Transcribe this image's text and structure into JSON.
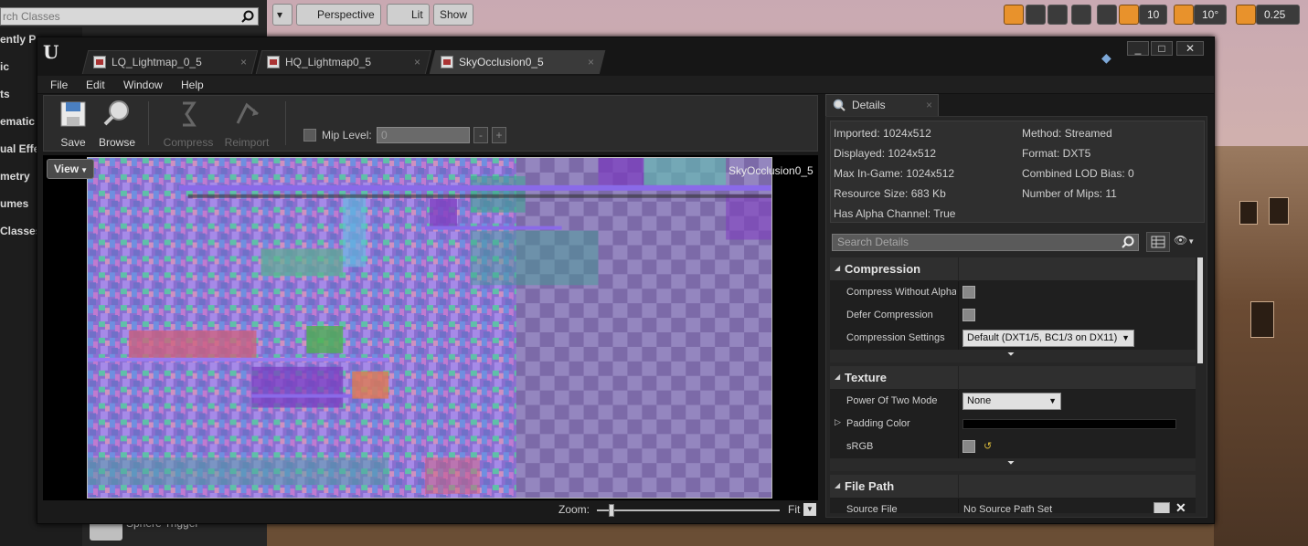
{
  "bg": {
    "search_placeholder": "rch Classes",
    "left_items": [
      "ently P",
      "ic",
      "ts",
      "ematic",
      "ual Effe",
      "metry",
      "umes",
      "Classes"
    ],
    "sphere_label": "Sphere Trigger",
    "vp_perspective": "Perspective",
    "vp_lit": "Lit",
    "vp_show": "Show",
    "vp_grid": "10",
    "vp_angle": "10°",
    "vp_scale": "0.25"
  },
  "window": {
    "tabs": [
      {
        "label": "LQ_Lightmap_0_5"
      },
      {
        "label": "HQ_Lightmap0_5"
      },
      {
        "label": "SkyOcclusion0_5"
      }
    ],
    "menu": [
      "File",
      "Edit",
      "Window",
      "Help"
    ],
    "toolbar": {
      "save": "Save",
      "browse": "Browse",
      "compress": "Compress",
      "reimport": "Reimport",
      "mip_label": "Mip Level:",
      "mip_value": "0",
      "minus": "-",
      "plus": "+"
    },
    "viewport": {
      "view_btn": "View",
      "texture_name": "SkyOcclusion0_5",
      "zoom_label": "Zoom:",
      "zoom_fraction": 0.08,
      "fit_label": "Fit"
    }
  },
  "details": {
    "tab_label": "Details",
    "info_left": [
      "Imported: 1024x512",
      "Displayed: 1024x512",
      "Max In-Game: 1024x512",
      "Resource Size: 683 Kb",
      "Has Alpha Channel: True"
    ],
    "info_right": [
      "Method: Streamed",
      "Format: DXT5",
      "Combined LOD Bias: 0",
      "Number of Mips: 11"
    ],
    "search_placeholder": "Search Details",
    "compression": {
      "title": "Compression",
      "compress_without_alpha": "Compress Without Alpha",
      "defer_compression": "Defer Compression",
      "compression_settings": "Compression Settings",
      "compression_settings_value": "Default (DXT1/5, BC1/3 on DX11)"
    },
    "texture": {
      "title": "Texture",
      "power_of_two": "Power Of Two Mode",
      "power_of_two_value": "None",
      "padding_color": "Padding Color",
      "srgb": "sRGB"
    },
    "file_path": {
      "title": "File Path",
      "source_file": "Source File",
      "source_value": "No Source Path Set"
    }
  },
  "colors": {
    "accent_orange": "#e8922c",
    "panel_bg": "#262626",
    "texture_bg": "#7c6aa8"
  }
}
